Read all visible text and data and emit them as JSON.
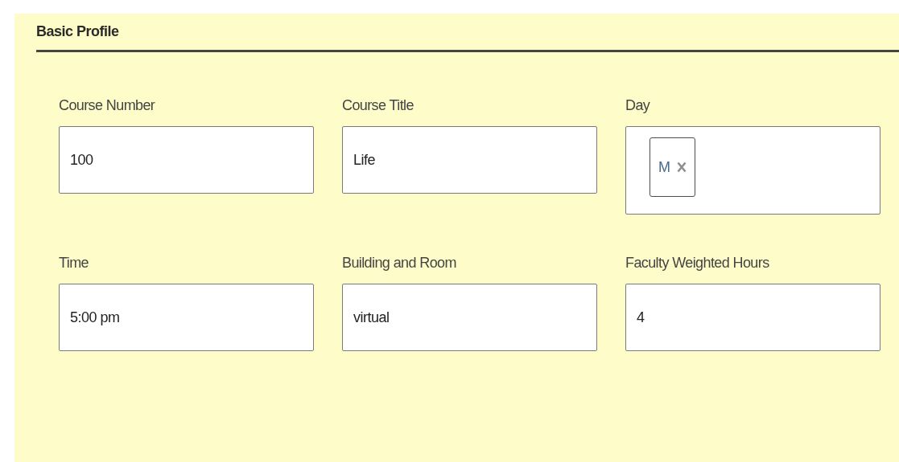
{
  "section": {
    "title": "Basic Profile"
  },
  "fields": [
    {
      "label": "Course Number",
      "kind": "text",
      "value": "100"
    },
    {
      "label": "Course Title",
      "kind": "text",
      "value": "Life"
    },
    {
      "label": "Day",
      "kind": "tags",
      "tags": [
        "M"
      ]
    },
    {
      "label": "Time",
      "kind": "text",
      "value": "5:00 pm"
    },
    {
      "label": "Building and Room",
      "kind": "text",
      "value": "virtual"
    },
    {
      "label": "Faculty Weighted Hours",
      "kind": "text",
      "value": "4"
    }
  ]
}
